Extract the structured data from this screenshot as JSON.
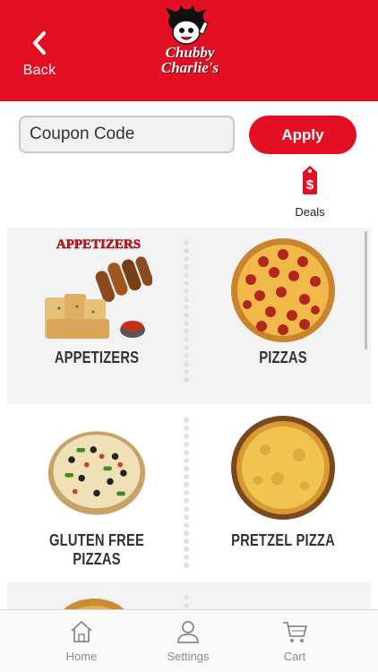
{
  "header": {
    "back_label": "Back",
    "logo_line1": "Chubby",
    "logo_line2": "Charlie's",
    "brand_color": "#e30f23"
  },
  "coupon": {
    "placeholder": "Coupon Code",
    "value": "",
    "apply_label": "Apply"
  },
  "deals": {
    "label": "Deals",
    "icon": "price-tag-dollar-icon"
  },
  "categories": [
    {
      "label": "APPETIZERS",
      "image_text": "APPETIZERS",
      "icon": "appetizers-image"
    },
    {
      "label": "PIZZAS",
      "icon": "pepperoni-pizza-image"
    },
    {
      "label": "GLUTEN FREE PIZZAS",
      "icon": "veggie-pizza-image"
    },
    {
      "label": "PRETZEL PIZZA",
      "icon": "cheese-pizza-image"
    }
  ],
  "tabbar": {
    "items": [
      {
        "label": "Home",
        "icon": "home-icon"
      },
      {
        "label": "Settings",
        "icon": "user-icon"
      },
      {
        "label": "Cart",
        "icon": "cart-icon"
      }
    ]
  }
}
